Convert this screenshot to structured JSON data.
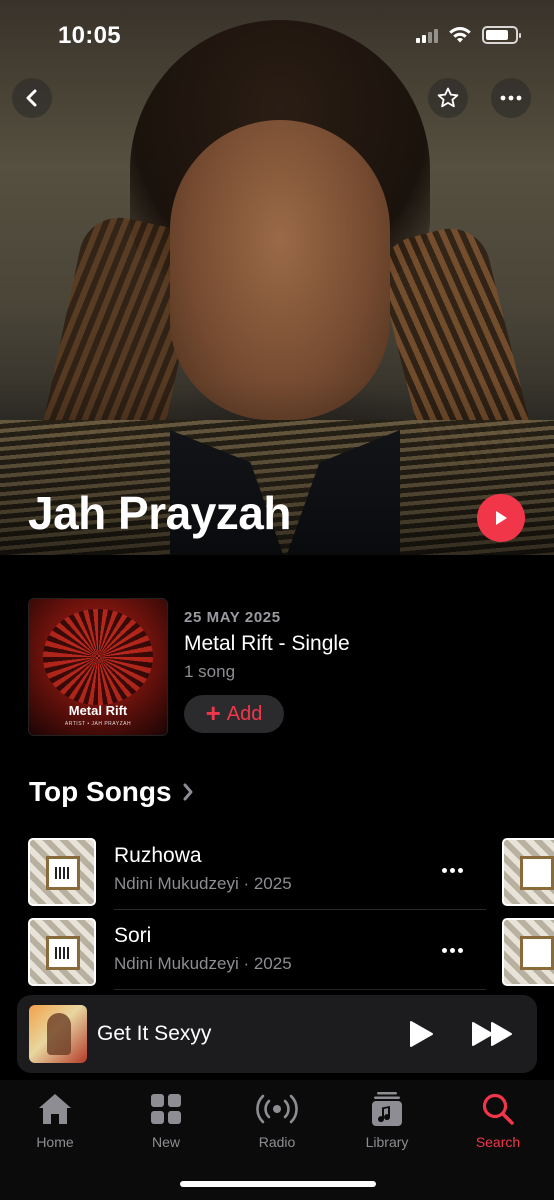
{
  "status_bar": {
    "time": "10:05"
  },
  "artist": {
    "name": "Jah Prayzah"
  },
  "latest_release": {
    "date": "25 MAY 2025",
    "title": "Metal Rift - Single",
    "song_count": "1 song",
    "add_label": "Add",
    "art_title": "Metal Rift",
    "art_subtitle": "ARTIST • JAH PRAYZAH"
  },
  "top_songs": {
    "heading": "Top Songs",
    "items": [
      {
        "title": "Ruzhowa",
        "meta": "Ndini Mukudzeyi · 2025"
      },
      {
        "title": "Sori",
        "meta": "Ndini Mukudzeyi · 2025"
      }
    ]
  },
  "now_playing": {
    "title": "Get It Sexyy"
  },
  "tabs": [
    {
      "label": "Home",
      "icon": "house-icon",
      "active": false
    },
    {
      "label": "New",
      "icon": "grid-icon",
      "active": false
    },
    {
      "label": "Radio",
      "icon": "radio-icon",
      "active": false
    },
    {
      "label": "Library",
      "icon": "library-icon",
      "active": false
    },
    {
      "label": "Search",
      "icon": "search-icon",
      "active": true
    }
  ],
  "colors": {
    "accent": "#f2364a",
    "background": "#000000",
    "secondary_text": "#8d8d93"
  }
}
